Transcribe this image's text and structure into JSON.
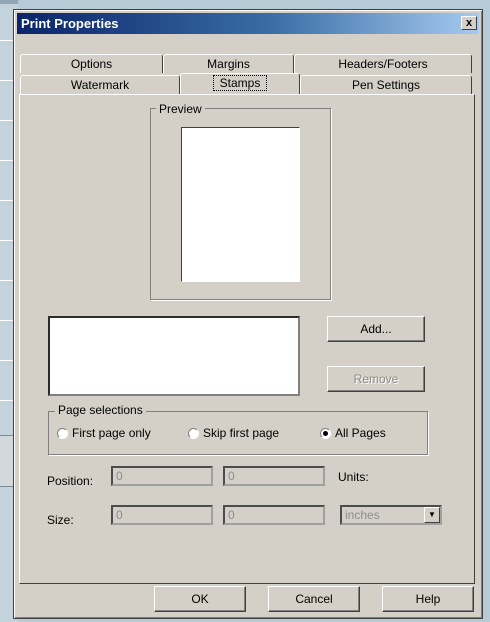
{
  "dialog": {
    "title": "Print Properties",
    "close_glyph": "x"
  },
  "tabs": {
    "row1": [
      "Options",
      "Margins",
      "Headers/Footers"
    ],
    "row2": [
      "Watermark",
      "Stamps",
      "Pen Settings"
    ],
    "active": "Stamps"
  },
  "preview": {
    "label": "Preview"
  },
  "buttons": {
    "add": "Add...",
    "remove": "Remove",
    "ok": "OK",
    "cancel": "Cancel",
    "help": "Help"
  },
  "page_selections": {
    "label": "Page selections",
    "options": [
      "First page only",
      "Skip first page",
      "All Pages"
    ],
    "selected": "All Pages"
  },
  "position": {
    "label": "Position:",
    "x": "0",
    "y": "0"
  },
  "units": {
    "label": "Units:",
    "value": "inches"
  },
  "size": {
    "label": "Size:",
    "w": "0",
    "h": "0"
  }
}
